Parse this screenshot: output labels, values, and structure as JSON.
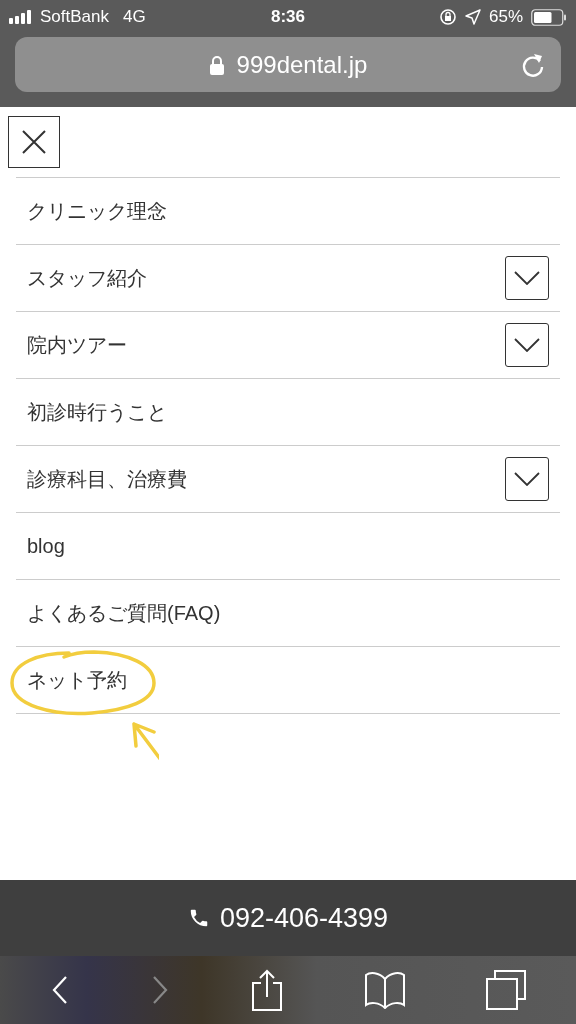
{
  "status_bar": {
    "carrier": "SoftBank",
    "network": "4G",
    "time": "8:36",
    "battery": "65%"
  },
  "address_bar": {
    "url": "999dental.jp",
    "secure": true
  },
  "menu": {
    "items": [
      {
        "label": "クリニック理念",
        "expandable": false
      },
      {
        "label": "スタッフ紹介",
        "expandable": true
      },
      {
        "label": "院内ツアー",
        "expandable": true
      },
      {
        "label": "初診時行うこと",
        "expandable": false
      },
      {
        "label": "診療科目、治療費",
        "expandable": true
      },
      {
        "label": "blog",
        "expandable": false
      },
      {
        "label": "よくあるご質問(FAQ)",
        "expandable": false
      },
      {
        "label": "ネット予約",
        "expandable": false
      }
    ]
  },
  "phone_bar": {
    "number": "092-406-4399"
  },
  "toolbar": {
    "back_enabled": true,
    "forward_enabled": false
  }
}
